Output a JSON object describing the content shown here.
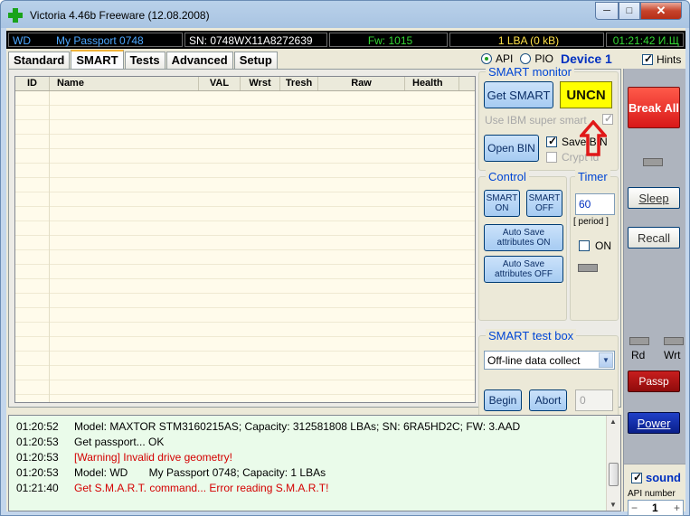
{
  "window": {
    "title": "Victoria 4.46b Freeware (12.08.2008)",
    "min": "─",
    "max": "□",
    "close": "✕"
  },
  "status": {
    "model_prefix": "WD",
    "model": "My Passport 0748",
    "serial": "SN: 0748WX11A8272639",
    "firmware": "Fw: 1015",
    "lba": "1 LBA (0 kB)",
    "time": "01:21:42 И.Щ"
  },
  "tabs": [
    "Standard",
    "SMART",
    "Tests",
    "Advanced",
    "Setup"
  ],
  "interface": {
    "api": "API",
    "pio": "PIO",
    "device": "Device 1",
    "hints": "Hints"
  },
  "grid": {
    "columns": [
      "ID",
      "Name",
      "VAL",
      "Wrst",
      "Tresh",
      "Raw",
      "Health"
    ]
  },
  "smart_monitor": {
    "title": "SMART monitor",
    "get_smart": "Get SMART",
    "status": "UNCN",
    "use_ibm": "Use IBM super smart",
    "open_bin": "Open BIN",
    "save_bin": "Save BIN",
    "crypt_id": "Crypt id"
  },
  "control": {
    "title": "Control",
    "smart_on": "SMART ON",
    "smart_off": "SMART OFF",
    "auto_on": "Auto Save attributes ON",
    "auto_off": "Auto Save attributes OFF"
  },
  "timer": {
    "title": "Timer",
    "value": "60",
    "period": "[ period ]",
    "on": "ON"
  },
  "test_box": {
    "title": "SMART test box",
    "selected": "Off-line data collect",
    "begin": "Begin",
    "abort": "Abort",
    "value": "0"
  },
  "side": {
    "break_all": "Break All",
    "sleep": "Sleep",
    "recall": "Recall",
    "rd": "Rd",
    "wrt": "Wrt",
    "passp": "Passp",
    "power": "Power",
    "sound": "sound",
    "api_number_label": "API number",
    "api_number": "1",
    "minus": "−",
    "plus": "+"
  },
  "log": [
    {
      "time": "01:20:52",
      "text": "Model: MAXTOR STM3160215AS; Capacity: 312581808 LBAs; SN: 6RA5HD2C; FW: 3.AAD",
      "error": false
    },
    {
      "time": "01:20:53",
      "text": "Get passport... OK",
      "error": false
    },
    {
      "time": "01:20:53",
      "text": "[Warning] Invalid drive geometry!",
      "error": true
    },
    {
      "time": "01:20:53",
      "text": "Model: WD       My Passport 0748; Capacity: 1 LBAs",
      "error": false
    },
    {
      "time": "01:21:40",
      "text": "Get S.M.A.R.T. command... Error reading S.M.A.R.T!",
      "error": true
    }
  ],
  "colors": {
    "arrow": "#e01818",
    "uncn_bg": "#ffff00",
    "break_bg": "#e02020"
  }
}
